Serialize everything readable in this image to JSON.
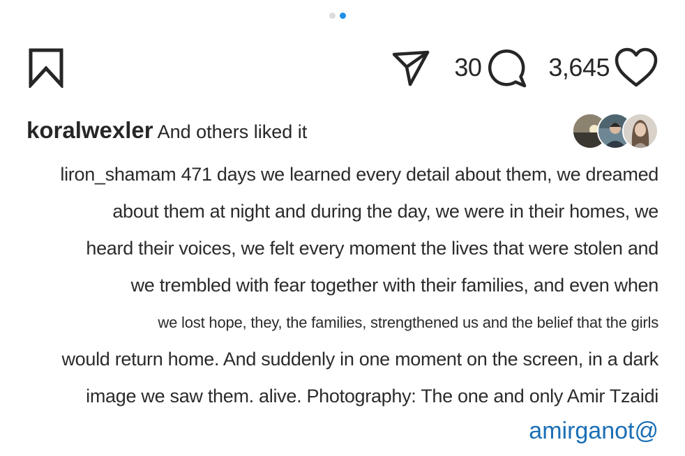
{
  "carousel": {
    "total": 2,
    "active_index": 1,
    "active_color": "#1d8fe8",
    "inactive_color": "#dcdcdc"
  },
  "actions": {
    "bookmark_icon": "bookmark-icon",
    "share_icon": "send-icon",
    "comment_icon": "comment-icon",
    "like_icon": "heart-icon",
    "comment_count": "30",
    "likes_count": "3,645"
  },
  "liked_by": {
    "username": "koralwexler",
    "suffix": "And others liked it",
    "avatars": [
      "avatar-sunset",
      "avatar-person",
      "avatar-portrait"
    ]
  },
  "caption": {
    "lines": [
      "liron_shamam 471 days we learned every detail about them, we dreamed",
      "about them at night and during the day, we were in their homes, we",
      "heard their voices, we felt every moment the lives that were stolen and",
      "we trembled with fear together with their families, and even when",
      "we lost hope, they, the families, strengthened us and the belief that the girls",
      "would return home. And suddenly in one moment on the screen, in a dark",
      "image we saw them. alive. Photography: The one and only Amir Tzaidi"
    ],
    "handle": "amirganot@",
    "handle_color": "#1a6fb5"
  }
}
